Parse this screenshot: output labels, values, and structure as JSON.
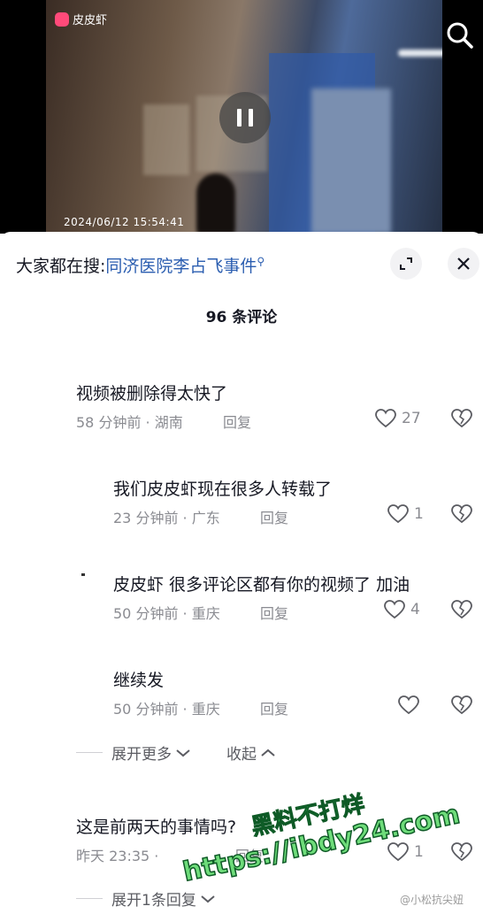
{
  "video": {
    "logo_text": "皮皮虾",
    "timestamp": "2024/06/12  15:54:41"
  },
  "sheet": {
    "hot_search_prefix": "大家都在搜:",
    "hot_search_topic": "同济医院李占飞事件",
    "comment_count": "96 条评论"
  },
  "comments": [
    {
      "text": "视频被删除得太快了",
      "time": "58 分钟前",
      "location": "湖南",
      "reply": "回复",
      "likes": "27"
    },
    {
      "text": "我们皮皮虾现在很多人转载了",
      "time": "23 分钟前",
      "location": "广东",
      "reply": "回复",
      "likes": "1"
    },
    {
      "text": "皮皮虾 很多评论区都有你的视频了 加油",
      "time": "50 分钟前",
      "location": "重庆",
      "reply": "回复",
      "likes": "4"
    },
    {
      "text": "继续发",
      "time": "50 分钟前",
      "location": "重庆",
      "reply": "回复",
      "likes": ""
    },
    {
      "text": "这是前两天的事情吗?",
      "time": "昨天 23:35",
      "location": "",
      "reply": "回复",
      "likes": "1"
    }
  ],
  "meta_lines": {
    "c0": "58 分钟前 · 湖南",
    "c1": "23 分钟前 · 广东",
    "c2": "50 分钟前 · 重庆",
    "c3": "50 分钟前 · 重庆",
    "c4": "昨天 23:35 ·"
  },
  "expand": {
    "more_label": "展开更多",
    "collapse_label": "收起",
    "one_reply_label": "展开1条回复"
  },
  "watermark": {
    "line1": "黑料不打烊",
    "line2": "https://ibdy24.com",
    "weibo": "@小松抗尖妞"
  },
  "icons": {
    "search": "search-icon",
    "pause": "pause-icon",
    "collapse": "collapse-icon",
    "close": "close-icon",
    "like": "heart-icon",
    "dislike": "broken-heart-icon",
    "chevron_down": "chevron-down-icon",
    "chevron_up": "chevron-up-icon"
  },
  "colors": {
    "topic_link": "#2a5db0",
    "muted": "#8a8b91",
    "text": "#161823",
    "watermark_green": "#2ab24a"
  }
}
